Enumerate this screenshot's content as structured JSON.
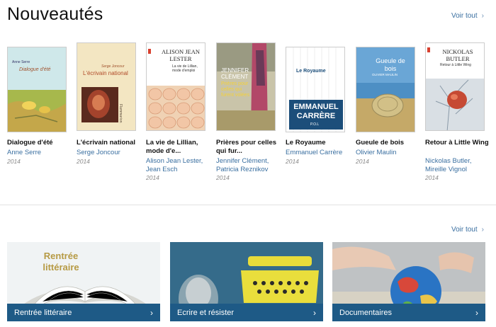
{
  "header": {
    "title": "Nouveautés",
    "voir_tout": "Voir tout",
    "chevron": "›"
  },
  "books": [
    {
      "title": "Dialogue d'été",
      "author": "Anne Serre",
      "year": "2014",
      "cover_text": {
        "author": "Anne Serre",
        "title": "Dialogue d'été",
        "publisher": ""
      }
    },
    {
      "title": "L'écrivain national",
      "author": "Serge Joncour",
      "year": "2014",
      "cover_text": {
        "author": "Serge Joncour",
        "title": "L'écrivain national",
        "publisher": "Flammarion"
      }
    },
    {
      "title": "La vie de Lillian, mode d'e...",
      "author": "Alison Jean Lester, Jean Esch",
      "year": "2014",
      "cover_text": {
        "author": "ALISON JEAN LESTER",
        "title": "La vie de Lillian, mode d'emploi"
      }
    },
    {
      "title": "Prières pour celles qui fur...",
      "author": "Jennifer Clément, Patricia Reznikov",
      "year": "2014",
      "cover_text": {
        "author": "JENNIFER CLÉMENT",
        "title": "Prières pour celles qui furent volées"
      }
    },
    {
      "title": "Le Royaume",
      "author": "Emmanuel Carrère",
      "year": "2014",
      "cover_text": {
        "title": "Le Royaume",
        "author": "EMMANUEL CARRÈRE",
        "publisher": "P.O.L"
      }
    },
    {
      "title": "Gueule de bois",
      "author": "Olivier Maulin",
      "year": "2014",
      "cover_text": {
        "title": "Gueule de bois",
        "author": "OLIVIER MAULIN"
      }
    },
    {
      "title": "Retour à Little Wing",
      "author": "Nickolas Butler, Mireille Vignol",
      "year": "2014",
      "cover_text": {
        "author": "NICKOLAS BUTLER",
        "title": "Retour à Little Wing"
      }
    }
  ],
  "categories": {
    "voir_tout": "Voir tout",
    "items": [
      {
        "label": "Rentrée littéraire",
        "art_text": "Rentrée littéraire"
      },
      {
        "label": "Ecrire et résister"
      },
      {
        "label": "Documentaires"
      }
    ]
  },
  "colors": {
    "accent": "#1e5a86",
    "link": "#3a6fa0"
  }
}
